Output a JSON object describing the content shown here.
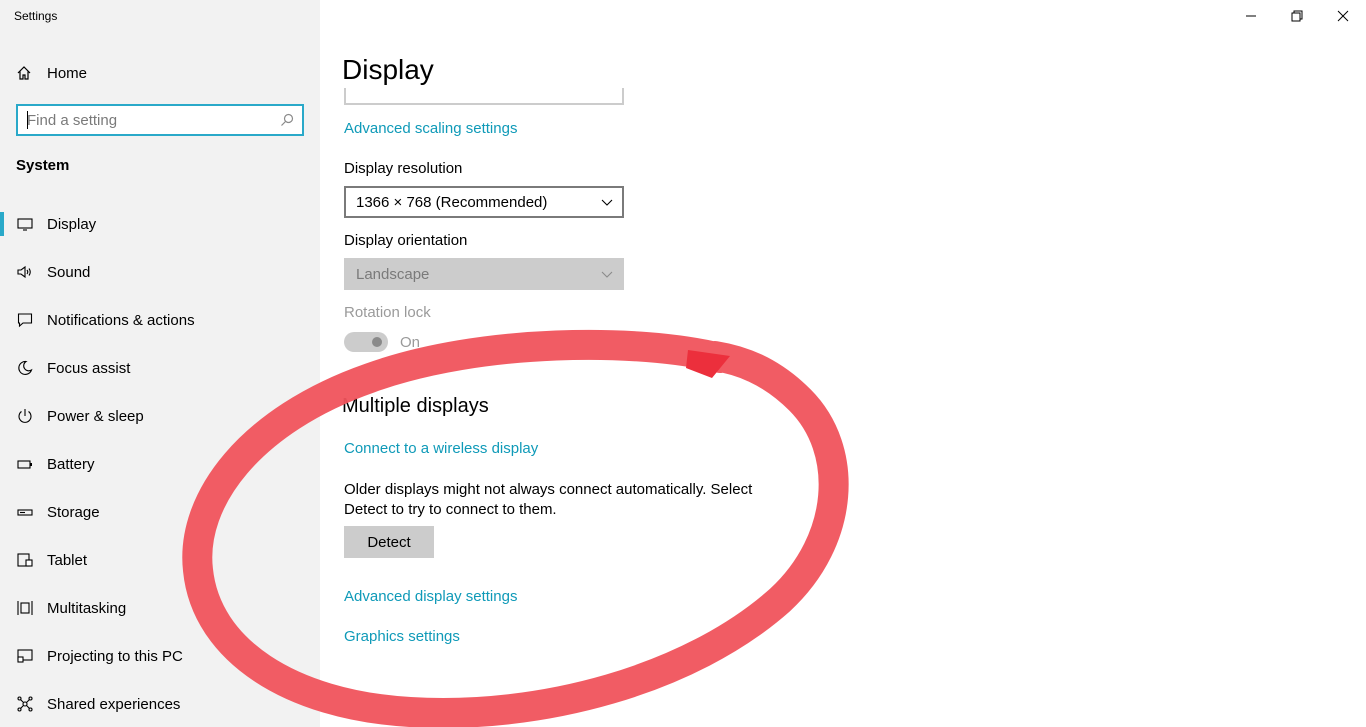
{
  "window": {
    "title": "Settings",
    "controls": [
      "minimize",
      "maximize",
      "close"
    ]
  },
  "sidebar": {
    "home_label": "Home",
    "search_placeholder": "Find a setting",
    "section_label": "System",
    "items": [
      {
        "label": "Display",
        "icon": "display-icon",
        "active": true
      },
      {
        "label": "Sound",
        "icon": "sound-icon"
      },
      {
        "label": "Notifications & actions",
        "icon": "notifications-icon"
      },
      {
        "label": "Focus assist",
        "icon": "focus-assist-icon"
      },
      {
        "label": "Power & sleep",
        "icon": "power-icon"
      },
      {
        "label": "Battery",
        "icon": "battery-icon"
      },
      {
        "label": "Storage",
        "icon": "storage-icon"
      },
      {
        "label": "Tablet",
        "icon": "tablet-icon"
      },
      {
        "label": "Multitasking",
        "icon": "multitasking-icon"
      },
      {
        "label": "Projecting to this PC",
        "icon": "projecting-icon"
      },
      {
        "label": "Shared experiences",
        "icon": "shared-experiences-icon"
      }
    ]
  },
  "main": {
    "title": "Display",
    "advanced_scaling_link": "Advanced scaling settings",
    "resolution_label": "Display resolution",
    "resolution_value": "1366 × 768 (Recommended)",
    "orientation_label": "Display orientation",
    "orientation_value": "Landscape",
    "rotation_lock_label": "Rotation lock",
    "rotation_lock_state": "On",
    "multiple_displays_title": "Multiple displays",
    "wireless_link": "Connect to a wireless display",
    "older_displays_text": "Older displays might not always connect automatically. Select Detect to try to connect to them.",
    "detect_button": "Detect",
    "advanced_display_link": "Advanced display settings",
    "graphics_link": "Graphics settings"
  },
  "colors": {
    "accent": "#2aa9c9",
    "link": "#0f9ab8",
    "annotation": "#f0535c"
  }
}
